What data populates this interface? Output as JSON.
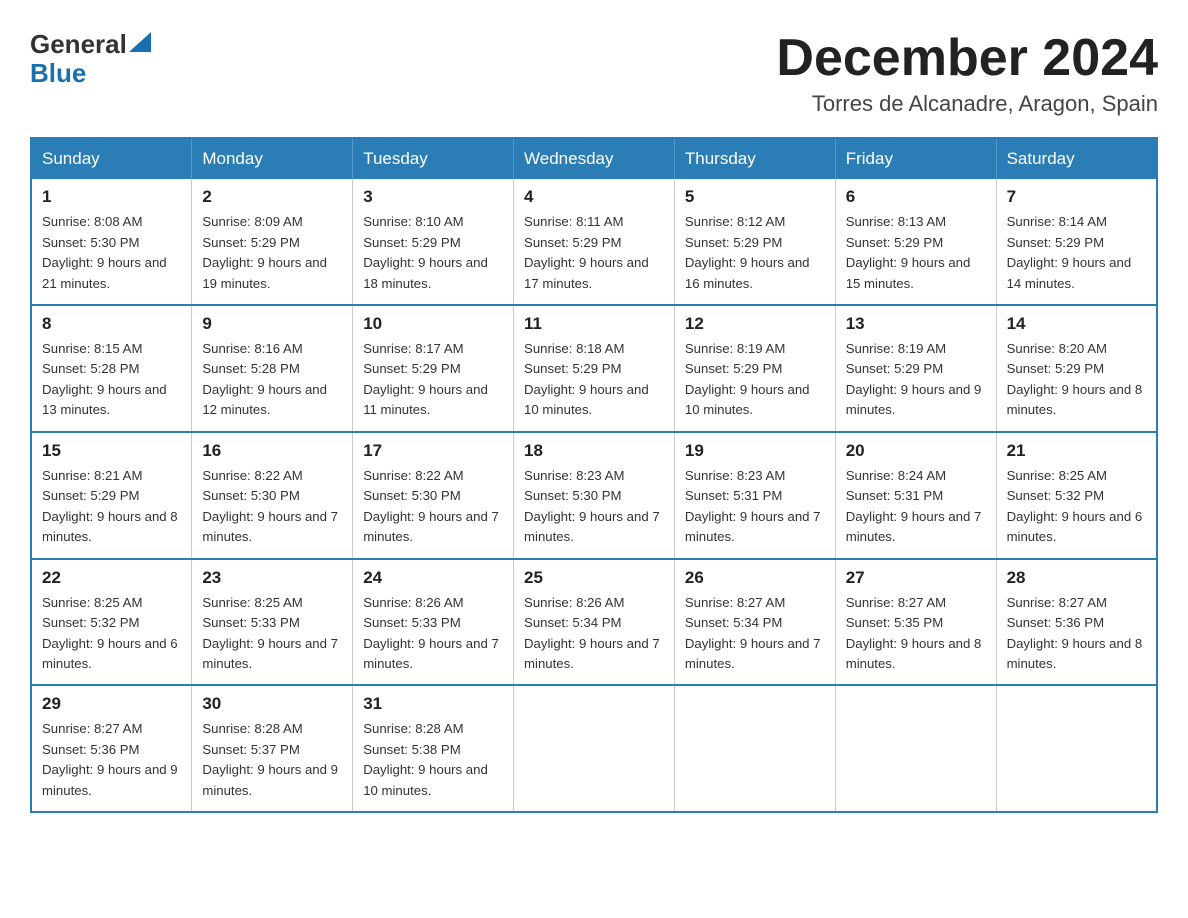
{
  "logo": {
    "general": "General",
    "blue": "Blue",
    "triangle": "▲"
  },
  "title": "December 2024",
  "location": "Torres de Alcanadre, Aragon, Spain",
  "headers": [
    "Sunday",
    "Monday",
    "Tuesday",
    "Wednesday",
    "Thursday",
    "Friday",
    "Saturday"
  ],
  "weeks": [
    [
      {
        "day": "1",
        "sunrise": "8:08 AM",
        "sunset": "5:30 PM",
        "daylight": "9 hours and 21 minutes."
      },
      {
        "day": "2",
        "sunrise": "8:09 AM",
        "sunset": "5:29 PM",
        "daylight": "9 hours and 19 minutes."
      },
      {
        "day": "3",
        "sunrise": "8:10 AM",
        "sunset": "5:29 PM",
        "daylight": "9 hours and 18 minutes."
      },
      {
        "day": "4",
        "sunrise": "8:11 AM",
        "sunset": "5:29 PM",
        "daylight": "9 hours and 17 minutes."
      },
      {
        "day": "5",
        "sunrise": "8:12 AM",
        "sunset": "5:29 PM",
        "daylight": "9 hours and 16 minutes."
      },
      {
        "day": "6",
        "sunrise": "8:13 AM",
        "sunset": "5:29 PM",
        "daylight": "9 hours and 15 minutes."
      },
      {
        "day": "7",
        "sunrise": "8:14 AM",
        "sunset": "5:29 PM",
        "daylight": "9 hours and 14 minutes."
      }
    ],
    [
      {
        "day": "8",
        "sunrise": "8:15 AM",
        "sunset": "5:28 PM",
        "daylight": "9 hours and 13 minutes."
      },
      {
        "day": "9",
        "sunrise": "8:16 AM",
        "sunset": "5:28 PM",
        "daylight": "9 hours and 12 minutes."
      },
      {
        "day": "10",
        "sunrise": "8:17 AM",
        "sunset": "5:29 PM",
        "daylight": "9 hours and 11 minutes."
      },
      {
        "day": "11",
        "sunrise": "8:18 AM",
        "sunset": "5:29 PM",
        "daylight": "9 hours and 10 minutes."
      },
      {
        "day": "12",
        "sunrise": "8:19 AM",
        "sunset": "5:29 PM",
        "daylight": "9 hours and 10 minutes."
      },
      {
        "day": "13",
        "sunrise": "8:19 AM",
        "sunset": "5:29 PM",
        "daylight": "9 hours and 9 minutes."
      },
      {
        "day": "14",
        "sunrise": "8:20 AM",
        "sunset": "5:29 PM",
        "daylight": "9 hours and 8 minutes."
      }
    ],
    [
      {
        "day": "15",
        "sunrise": "8:21 AM",
        "sunset": "5:29 PM",
        "daylight": "9 hours and 8 minutes."
      },
      {
        "day": "16",
        "sunrise": "8:22 AM",
        "sunset": "5:30 PM",
        "daylight": "9 hours and 7 minutes."
      },
      {
        "day": "17",
        "sunrise": "8:22 AM",
        "sunset": "5:30 PM",
        "daylight": "9 hours and 7 minutes."
      },
      {
        "day": "18",
        "sunrise": "8:23 AM",
        "sunset": "5:30 PM",
        "daylight": "9 hours and 7 minutes."
      },
      {
        "day": "19",
        "sunrise": "8:23 AM",
        "sunset": "5:31 PM",
        "daylight": "9 hours and 7 minutes."
      },
      {
        "day": "20",
        "sunrise": "8:24 AM",
        "sunset": "5:31 PM",
        "daylight": "9 hours and 7 minutes."
      },
      {
        "day": "21",
        "sunrise": "8:25 AM",
        "sunset": "5:32 PM",
        "daylight": "9 hours and 6 minutes."
      }
    ],
    [
      {
        "day": "22",
        "sunrise": "8:25 AM",
        "sunset": "5:32 PM",
        "daylight": "9 hours and 6 minutes."
      },
      {
        "day": "23",
        "sunrise": "8:25 AM",
        "sunset": "5:33 PM",
        "daylight": "9 hours and 7 minutes."
      },
      {
        "day": "24",
        "sunrise": "8:26 AM",
        "sunset": "5:33 PM",
        "daylight": "9 hours and 7 minutes."
      },
      {
        "day": "25",
        "sunrise": "8:26 AM",
        "sunset": "5:34 PM",
        "daylight": "9 hours and 7 minutes."
      },
      {
        "day": "26",
        "sunrise": "8:27 AM",
        "sunset": "5:34 PM",
        "daylight": "9 hours and 7 minutes."
      },
      {
        "day": "27",
        "sunrise": "8:27 AM",
        "sunset": "5:35 PM",
        "daylight": "9 hours and 8 minutes."
      },
      {
        "day": "28",
        "sunrise": "8:27 AM",
        "sunset": "5:36 PM",
        "daylight": "9 hours and 8 minutes."
      }
    ],
    [
      {
        "day": "29",
        "sunrise": "8:27 AM",
        "sunset": "5:36 PM",
        "daylight": "9 hours and 9 minutes."
      },
      {
        "day": "30",
        "sunrise": "8:28 AM",
        "sunset": "5:37 PM",
        "daylight": "9 hours and 9 minutes."
      },
      {
        "day": "31",
        "sunrise": "8:28 AM",
        "sunset": "5:38 PM",
        "daylight": "9 hours and 10 minutes."
      },
      null,
      null,
      null,
      null
    ]
  ]
}
